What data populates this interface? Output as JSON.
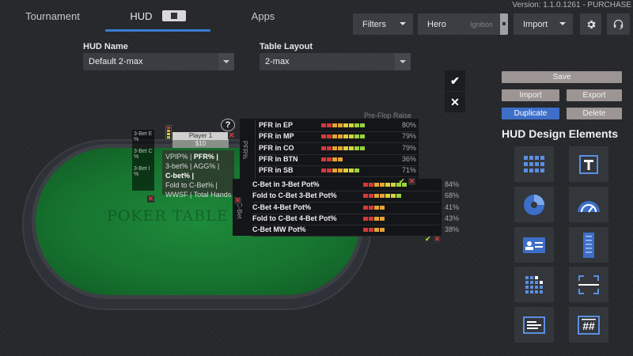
{
  "topbar": {
    "tabs": [
      {
        "label": "Tournament"
      },
      {
        "label": "HUD",
        "active": true
      },
      {
        "label": "Apps"
      }
    ],
    "version": "Version: 1.1.0.1261 - PURCHASE",
    "filters_label": "Filters",
    "hero_label": "Hero",
    "hero_site": "Ignition",
    "import_label": "Import"
  },
  "hud_config": {
    "hud_name_label": "HUD Name",
    "hud_name_value": "Default 2-max",
    "table_layout_label": "Table Layout",
    "table_layout_value": "2-max"
  },
  "actions": {
    "save": "Save",
    "import": "Import",
    "export": "Export",
    "duplicate": "Duplicate",
    "delete": "Delete"
  },
  "design_elements": {
    "title": "HUD Design Elements",
    "tiles": [
      "grid-icon",
      "text-icon",
      "pie-chart-icon",
      "gauge-icon",
      "card-icon",
      "list-icon",
      "small-grid-icon",
      "crop-icon",
      "badge-icon",
      "hash-icon"
    ]
  },
  "table": {
    "label": "POKER TABLE",
    "player_name": "Player 1",
    "player_stack": "$10",
    "side_stats": [
      "3-Bet E",
      "%",
      "3-Bet C",
      "%",
      "3-Bet I",
      "%"
    ],
    "stats_lines": [
      [
        "VPIP% |",
        "PFR% |"
      ],
      [
        "3-bet% |",
        "AGG% |"
      ],
      [
        "C-bet% |"
      ],
      [
        "Fold to C-Bet% |"
      ],
      [
        "WWSF |",
        "Total Hands"
      ]
    ]
  },
  "preflop_popup": {
    "title": "Pre-Flop Raise",
    "side_label": "PFR%",
    "rows": [
      {
        "label": "PFR in EP",
        "pct": "80%",
        "fill": 0.8
      },
      {
        "label": "PFR in MP",
        "pct": "79%",
        "fill": 0.79
      },
      {
        "label": "PFR in CO",
        "pct": "79%",
        "fill": 0.79
      },
      {
        "label": "PFR in BTN",
        "pct": "36%",
        "fill": 0.36
      },
      {
        "label": "PFR in SB",
        "pct": "71%",
        "fill": 0.71
      }
    ]
  },
  "cbet_popup": {
    "side_label": "C-Bet",
    "rows": [
      {
        "label": "C-Bet in 3-Bet Pot%",
        "pct": "84%",
        "fill": 0.84
      },
      {
        "label": "Fold to C-Bet 3-Bet Pot%",
        "pct": "68%",
        "fill": 0.68
      },
      {
        "label": "C-Bet 4-Bet Pot%",
        "pct": "41%",
        "fill": 0.41
      },
      {
        "label": "Fold to C-Bet 4-Bet Pot%",
        "pct": "43%",
        "fill": 0.43
      },
      {
        "label": "C-Bet MW Pot%",
        "pct": "38%",
        "fill": 0.38
      }
    ]
  },
  "colors": {
    "accent": "#3a7bd5",
    "felt": "#177530",
    "bar_red": "#d23a3a",
    "bar_orange": "#e5a336",
    "bar_yellow": "#d9d23a",
    "bar_green": "#9ad23c"
  }
}
